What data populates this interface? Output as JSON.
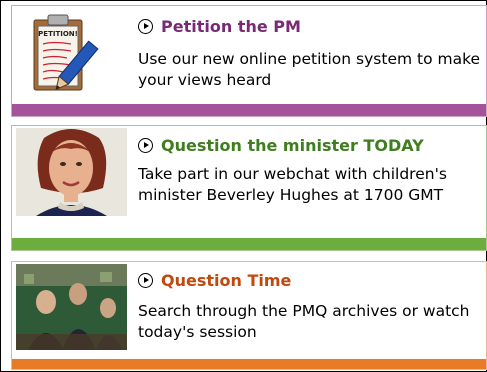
{
  "cards": [
    {
      "title": "Petition the PM",
      "description": "Use our new online petition system to make your views heard",
      "color": "#a3529b",
      "title_color": "#7a2a75",
      "image_text": "PETITION!"
    },
    {
      "title": "Question the minister TODAY",
      "description": "Take part in our webchat with children's minister Beverley Hughes at 1700 GMT",
      "color": "#6cad3d",
      "title_color": "#3f7d1f"
    },
    {
      "title": "Question Time",
      "description": "Search through the PMQ archives or watch today's session",
      "color": "#ea7b25",
      "title_color": "#c0490f"
    }
  ]
}
